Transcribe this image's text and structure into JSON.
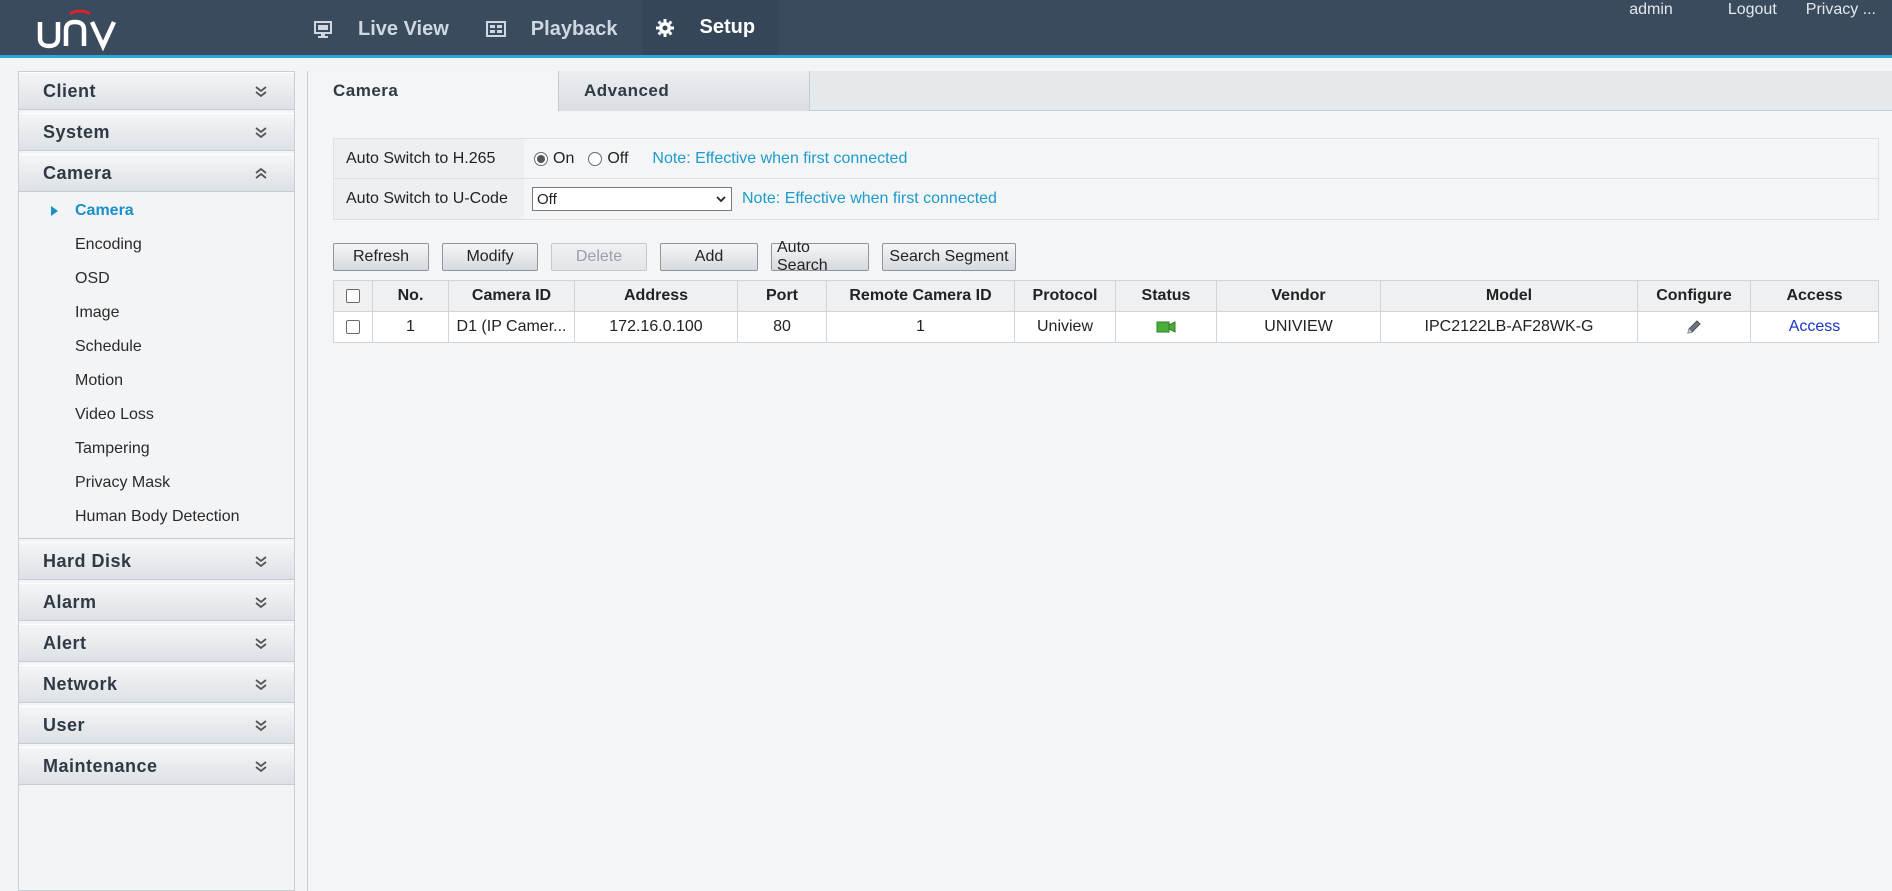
{
  "brand": {
    "logo_text": "UNV"
  },
  "nav": [
    {
      "label": "Live View",
      "icon": "monitor-icon"
    },
    {
      "label": "Playback",
      "icon": "film-icon"
    },
    {
      "label": "Setup",
      "icon": "gear-icon"
    }
  ],
  "top_links": {
    "user": "admin",
    "logout": "Logout",
    "privacy": "Privacy ..."
  },
  "sidebar": {
    "groups": [
      {
        "label": "Client"
      },
      {
        "label": "System"
      },
      {
        "label": "Camera"
      },
      {
        "label": "Hard Disk"
      },
      {
        "label": "Alarm"
      },
      {
        "label": "Alert"
      },
      {
        "label": "Network"
      },
      {
        "label": "User"
      },
      {
        "label": "Maintenance"
      }
    ],
    "camera_items": [
      "Camera",
      "Encoding",
      "OSD",
      "Image",
      "Schedule",
      "Motion",
      "Video Loss",
      "Tampering",
      "Privacy Mask",
      "Human Body Detection"
    ]
  },
  "tabs": [
    "Camera",
    "Advanced"
  ],
  "settings": {
    "h265": {
      "label": "Auto Switch to H.265",
      "on": "On",
      "off": "Off",
      "note": "Note: Effective when first connected"
    },
    "ucode": {
      "label": "Auto Switch to U-Code",
      "value": "Off",
      "note": "Note: Effective when first connected"
    }
  },
  "buttons": {
    "refresh": "Refresh",
    "modify": "Modify",
    "delete": "Delete",
    "add": "Add",
    "auto_search": "Auto Search",
    "search_segment": "Search Segment"
  },
  "table": {
    "headers": [
      "No.",
      "Camera ID",
      "Address",
      "Port",
      "Remote Camera ID",
      "Protocol",
      "Status",
      "Vendor",
      "Model",
      "Configure",
      "Access"
    ],
    "rows": [
      {
        "no": "1",
        "camera_id": "D1 (IP Camer...",
        "address": "172.16.0.100",
        "port": "80",
        "remote_id": "1",
        "protocol": "Uniview",
        "status_icon": "camera-online-icon",
        "vendor": "UNIVIEW",
        "model": "IPC2122LB-AF28WK-G",
        "configure_icon": "pencil-icon",
        "access": "Access"
      }
    ]
  },
  "colors": {
    "topbar": "#3b4b5e",
    "accent": "#29a7d6",
    "note": "#1d9bc9",
    "link": "#1b33c9",
    "status_online": "#4cae3a"
  }
}
